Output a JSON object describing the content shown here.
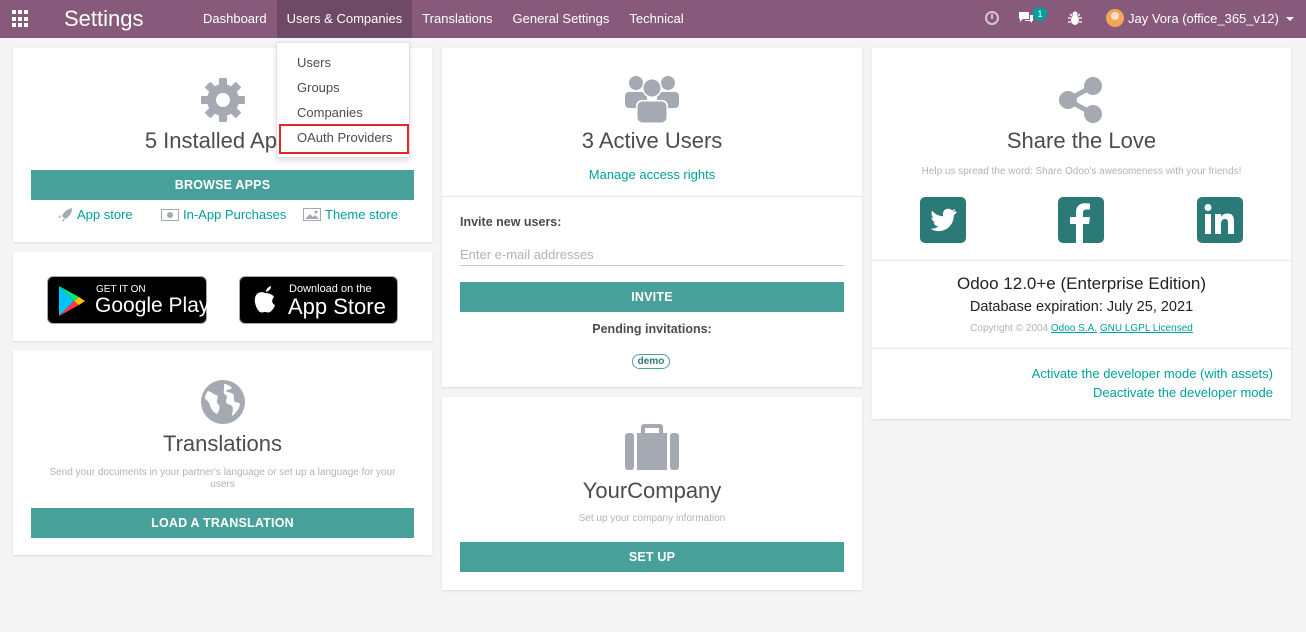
{
  "topbar": {
    "brand": "Settings",
    "menu": [
      "Dashboard",
      "Users & Companies",
      "Translations",
      "General Settings",
      "Technical"
    ],
    "active_menu_index": 1,
    "chat_count": "1",
    "user_name": "Jay Vora (office_365_v12)"
  },
  "dropdown": {
    "items": [
      "Users",
      "Groups",
      "Companies",
      "OAuth Providers"
    ],
    "highlighted": "OAuth Providers"
  },
  "apps_card": {
    "title": "5 Installed Apps",
    "button": "BROWSE APPS",
    "links": [
      "App store",
      "In-App Purchases",
      "Theme store"
    ]
  },
  "store_badges": {
    "google": {
      "small": "GET IT ON",
      "big": "Google Play"
    },
    "apple": {
      "small": "Download on the",
      "big": "App Store"
    }
  },
  "translations_card": {
    "title": "Translations",
    "description": "Send your documents in your partner's language or set up a language for your users",
    "button": "LOAD A TRANSLATION"
  },
  "users_card": {
    "title": "3 Active Users",
    "manage_link": "Manage access rights",
    "invite_label": "Invite new users:",
    "email_placeholder": "Enter e-mail addresses",
    "invite_button": "INVITE",
    "pending_label": "Pending invitations:",
    "pending_tag": "demo"
  },
  "company_card": {
    "title": "YourCompany",
    "description": "Set up your company information",
    "button": "SET UP"
  },
  "share_card": {
    "title": "Share the Love",
    "description": "Help us spread the word: Share Odoo's awesomeness with your friends!",
    "version": "Odoo 12.0+e (Enterprise Edition)",
    "expiration": "Database expiration: July 25, 2021",
    "copyright_prefix": "Copyright © 2004",
    "company_link": "Odoo S.A.",
    "license_link": "GNU LGPL Licensed",
    "dev_mode_assets": "Activate the developer mode (with assets)",
    "dev_mode_off": "Deactivate the developer mode"
  },
  "colors": {
    "topbar": "#875a7b",
    "accent": "#48a09b",
    "link": "#00a09d",
    "highlight_border": "#e0262b"
  }
}
